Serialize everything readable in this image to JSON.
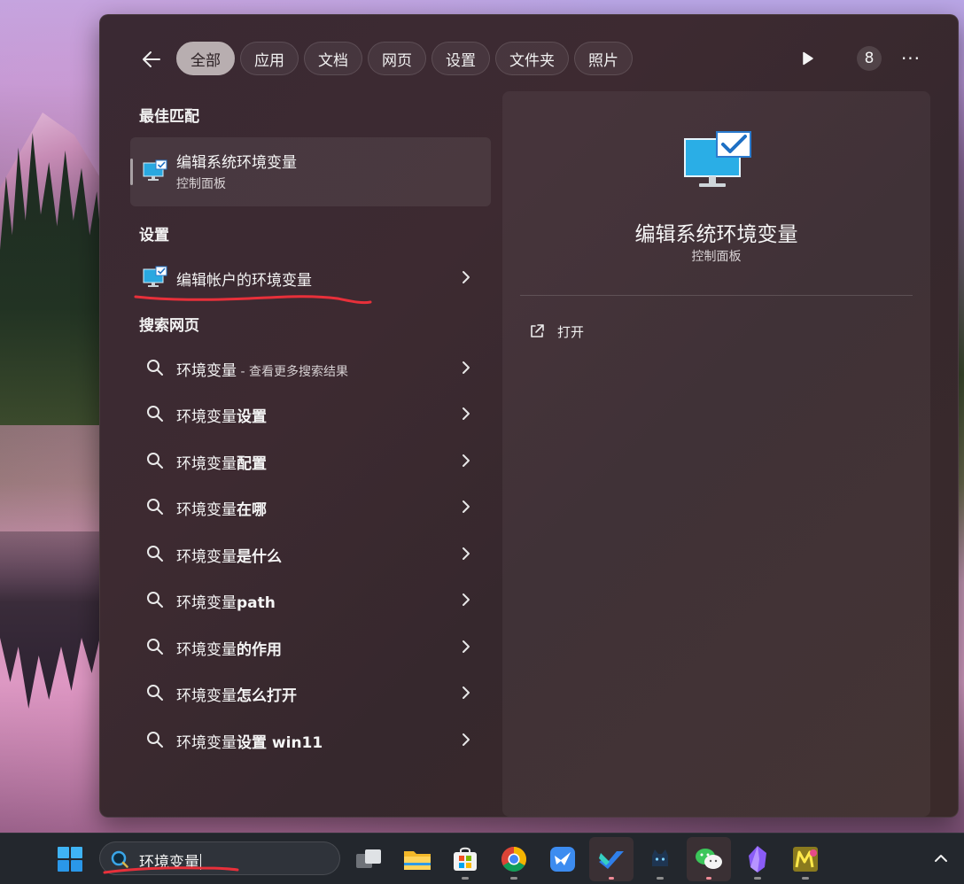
{
  "filters": {
    "chips": [
      {
        "label": "全部",
        "active": true
      },
      {
        "label": "应用"
      },
      {
        "label": "文档"
      },
      {
        "label": "网页"
      },
      {
        "label": "设置"
      },
      {
        "label": "文件夹"
      },
      {
        "label": "照片"
      }
    ],
    "count": "8",
    "more": "···"
  },
  "best_match": {
    "heading": "最佳匹配",
    "title": "编辑系统环境变量",
    "subtitle": "控制面板",
    "icon": "monitor-check-icon"
  },
  "settings": {
    "heading": "设置",
    "item": {
      "label": "编辑帐户的环境变量",
      "icon": "monitor-check-icon"
    }
  },
  "web": {
    "heading": "搜索网页",
    "items": [
      {
        "base": "环境变量",
        "bold": "",
        "hint": " - 查看更多搜索结果"
      },
      {
        "base": "环境变量",
        "bold": "设置",
        "hint": ""
      },
      {
        "base": "环境变量",
        "bold": "配置",
        "hint": ""
      },
      {
        "base": "环境变量",
        "bold": "在哪",
        "hint": ""
      },
      {
        "base": "环境变量",
        "bold": "是什么",
        "hint": ""
      },
      {
        "base": "环境变量",
        "bold": "path",
        "hint": ""
      },
      {
        "base": "环境变量",
        "bold": "的作用",
        "hint": ""
      },
      {
        "base": "环境变量",
        "bold": "怎么打开",
        "hint": ""
      },
      {
        "base": "环境变量",
        "bold": "设置 win11",
        "hint": ""
      }
    ]
  },
  "preview": {
    "title": "编辑系统环境变量",
    "subtitle": "控制面板",
    "actions": [
      {
        "label": "打开",
        "icon": "open-external-icon"
      }
    ]
  },
  "taskbar": {
    "search_text": "环境变量",
    "apps": [
      "task-view-icon",
      "file-explorer-icon",
      "microsoft-store-icon",
      "chrome-icon",
      "feishu-icon",
      "app-blue-icon",
      "cat-app-icon",
      "wechat-icon",
      "obsidian-icon",
      "m2-app-icon"
    ]
  },
  "colors": {
    "panel": "#3a2933",
    "chip_active": "#b8aeb0",
    "annotation_red": "#e8303a",
    "taskbar": "#23272d"
  }
}
